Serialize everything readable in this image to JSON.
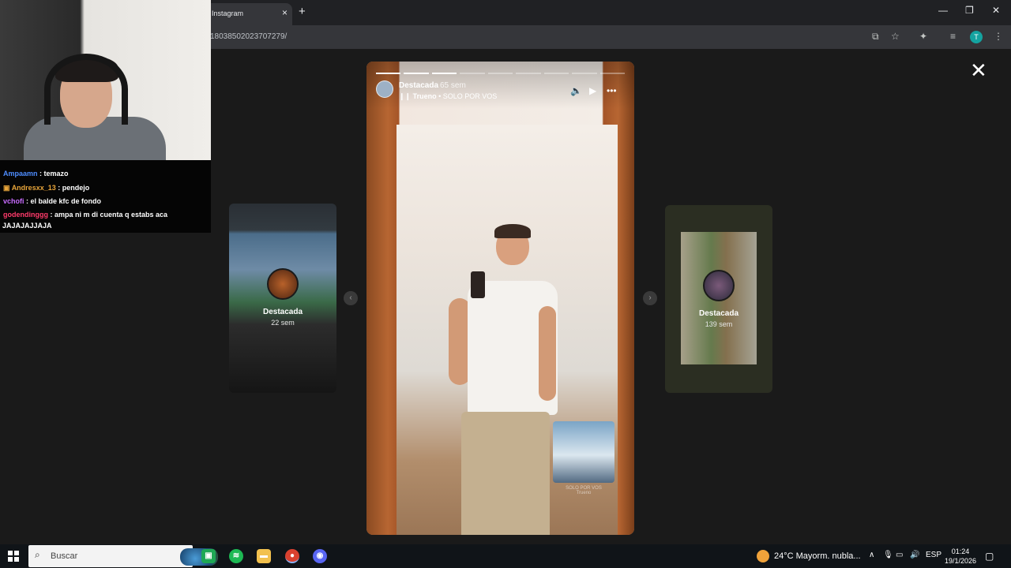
{
  "browser": {
    "tab_title": "Instagram",
    "tab_close": "×",
    "new_tab": "+",
    "url": "18038502023707279/",
    "profile_initial": "T",
    "controls": {
      "minimize": "—",
      "restore": "❐",
      "close": "✕"
    }
  },
  "viewer": {
    "close": "✕",
    "prev": "‹",
    "next": "›",
    "left_story": {
      "title": "Destacada",
      "time": "22 sem"
    },
    "right_story": {
      "title": "Destacada",
      "time": "139 sem"
    },
    "main_story": {
      "name": "Destacada",
      "time": "65 sem",
      "song_title": "Trueno",
      "song_separator": " • ",
      "song_name": "SOLO POR VOS",
      "progress_segments": 9,
      "progress_done": 3,
      "sticker_text": "SOLO POR VOS",
      "sticker_sub": "Trueno"
    }
  },
  "chat": [
    {
      "user": "Ampaamn",
      "text": ": temazo",
      "color": "#4e8dff"
    },
    {
      "user": "Andresxx_13",
      "text": ": pendejo",
      "color": "#e8a53a"
    },
    {
      "user": "vchofi",
      "text": ": el balde kfc de fondo",
      "color": "#c86cff"
    },
    {
      "user": "godendinggg",
      "text": ": ampa ni m di cuenta q estabs aca",
      "color": "#ff3b6b"
    },
    {
      "user": "",
      "text": "JAJAJAJJAJA",
      "color": "#ffffff"
    }
  ],
  "taskbar": {
    "search_placeholder": "Buscar",
    "weather": "24°C  Mayorm. nubla...",
    "lang": "ESP",
    "time": "01:24",
    "date": "19/1/2026"
  }
}
